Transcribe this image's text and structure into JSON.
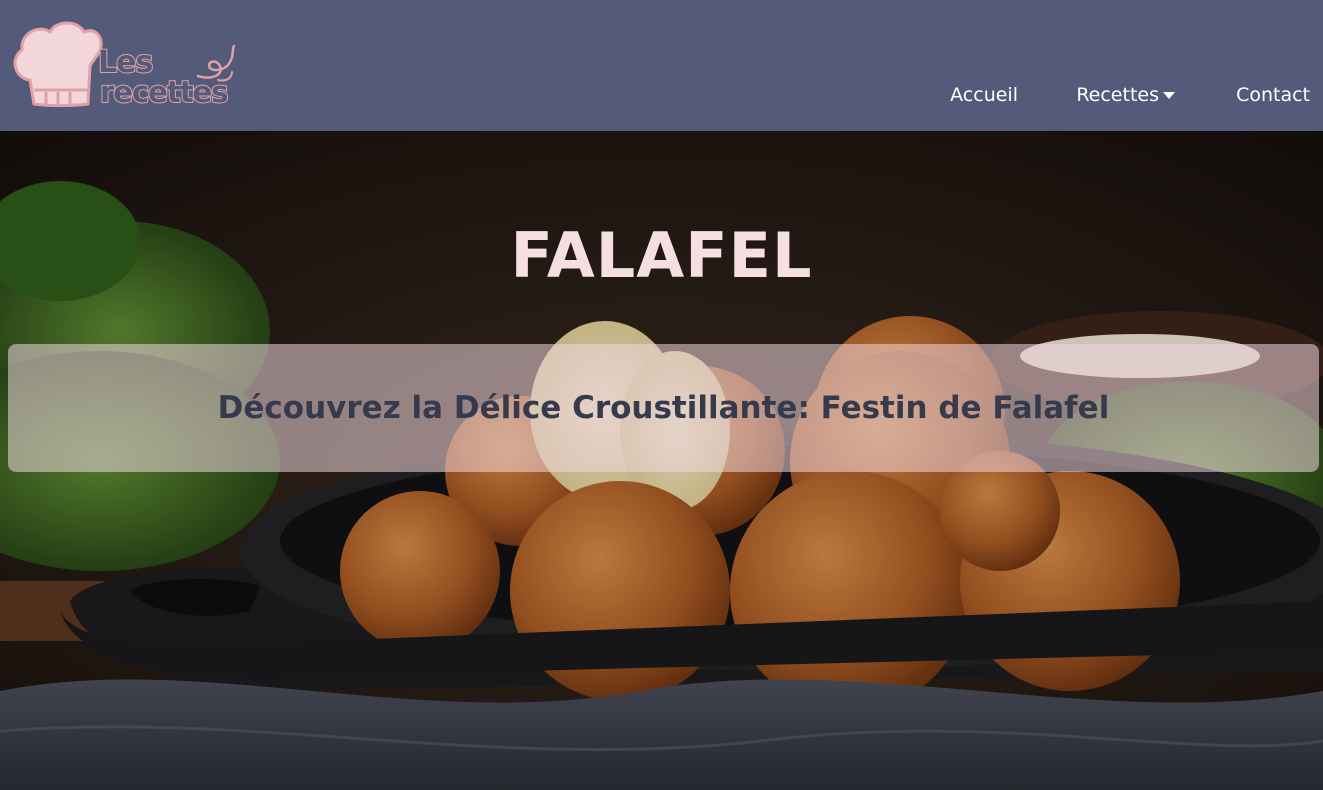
{
  "header": {
    "logo": {
      "line1": "Les",
      "line2": "recettes"
    },
    "nav": {
      "items": [
        {
          "label": "Accueil"
        },
        {
          "label": "Recettes",
          "has_dropdown": true
        },
        {
          "label": "Contact"
        }
      ]
    }
  },
  "hero": {
    "title": "FALAFEL",
    "subtitle": "Découvrez la Délice Croustillante: Festin de Falafel"
  },
  "colors": {
    "header_bg": "#545a7a",
    "logo_accent": "#e0a1a6",
    "title": "#f6dfe3",
    "subtitle_text": "#363a4d",
    "subtitle_band": "rgba(240,215,222,0.55)"
  },
  "icons": {
    "logo": "chef-hat-icon",
    "dropdown": "caret-down-icon"
  }
}
